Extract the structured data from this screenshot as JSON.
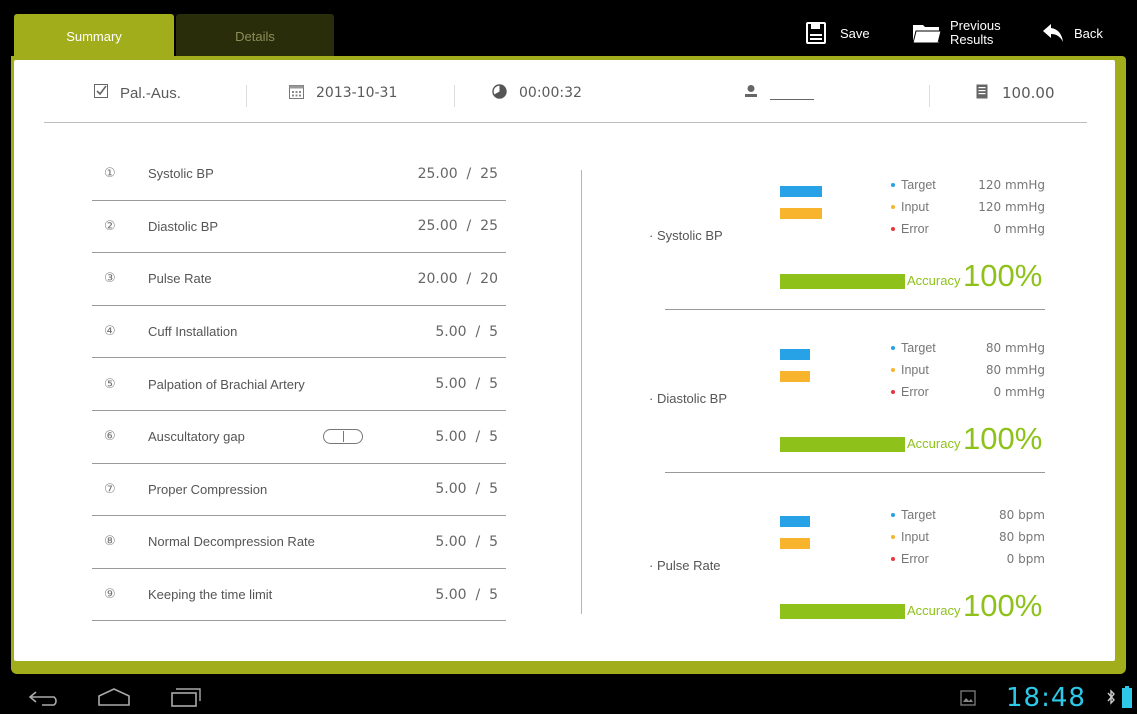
{
  "tabs": [
    {
      "label": "Summary",
      "active": true
    },
    {
      "label": "Details",
      "active": false
    }
  ],
  "toolbar": {
    "save_label": "Save",
    "previous_line1": "Previous",
    "previous_line2": "Results",
    "back_label": "Back"
  },
  "info": {
    "mode": "Pal.-Aus.",
    "date": "2013-10-31",
    "elapsed": "00:00:32",
    "user": "",
    "total": "100.00"
  },
  "criteria": [
    {
      "num": "①",
      "name": "Systolic BP",
      "score": "25.00  /  25"
    },
    {
      "num": "②",
      "name": "Diastolic BP",
      "score": "25.00  /  25"
    },
    {
      "num": "③",
      "name": "Pulse Rate",
      "score": "20.00  /  20"
    },
    {
      "num": "④",
      "name": "Cuff Installation",
      "score": "5.00  /  5"
    },
    {
      "num": "⑤",
      "name": "Palpation of Brachial Artery",
      "score": "5.00  /  5"
    },
    {
      "num": "⑥",
      "name": "Auscultatory gap",
      "score": "5.00  /  5"
    },
    {
      "num": "⑦",
      "name": "Proper Compression",
      "score": "5.00  /  5"
    },
    {
      "num": "⑧",
      "name": "Normal Decompression Rate",
      "score": "5.00  /  5"
    },
    {
      "num": "⑨",
      "name": "Keeping the time limit",
      "score": "5.00  /  5"
    }
  ],
  "results": [
    {
      "title": "· Systolic BP",
      "target_label": "Target",
      "target": "120 mmHg",
      "input_label": "Input",
      "input": "120 mmHg",
      "error_label": "Error",
      "error": "0 mmHg",
      "accuracy_label": "Accuracy",
      "accuracy": "100%",
      "accuracy_fraction": 1.0
    },
    {
      "title": "· Diastolic BP",
      "target_label": "Target",
      "target": "80 mmHg",
      "input_label": "Input",
      "input": "80 mmHg",
      "error_label": "Error",
      "error": "0 mmHg",
      "accuracy_label": "Accuracy",
      "accuracy": "100%",
      "accuracy_fraction": 1.0
    },
    {
      "title": "· Pulse Rate",
      "target_label": "Target",
      "target": "80 bpm",
      "input_label": "Input",
      "input": "80 bpm",
      "error_label": "Error",
      "error": "0 bpm",
      "accuracy_label": "Accuracy",
      "accuracy": "100%",
      "accuracy_fraction": 1.0
    }
  ],
  "colors": {
    "accent": "#a2ad1b",
    "target": "#27a2e6",
    "input": "#f7b42c",
    "error": "#e8373b",
    "accuracy": "#8ec21b",
    "clock": "#2ec8e8"
  },
  "system": {
    "clock": "18:48"
  }
}
